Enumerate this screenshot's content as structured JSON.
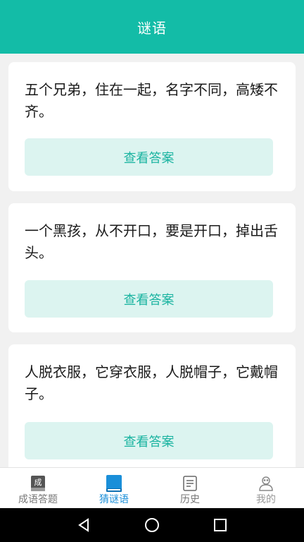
{
  "header": {
    "title": "谜语"
  },
  "riddles": [
    {
      "text": "五个兄弟，住在一起，名字不同，高矮不齐。",
      "button": "查看答案"
    },
    {
      "text": "一个黑孩，从不开口，要是开口，掉出舌头。",
      "button": "查看答案"
    },
    {
      "text": "人脱衣服，它穿衣服，人脱帽子，它戴帽子。",
      "button": "查看答案"
    }
  ],
  "tabs": [
    {
      "label": "成语答题",
      "icon": "idiom-book-icon",
      "badge": "成"
    },
    {
      "label": "猜谜语",
      "icon": "blue-book-icon",
      "active": true
    },
    {
      "label": "历史",
      "icon": "document-icon"
    },
    {
      "label": "我的",
      "icon": "person-icon"
    }
  ],
  "colors": {
    "primary": "#13bca7",
    "active_tab": "#1a8fd9",
    "answer_button_bg": "#dcf4f0",
    "answer_button_text": "#19b3a0"
  }
}
